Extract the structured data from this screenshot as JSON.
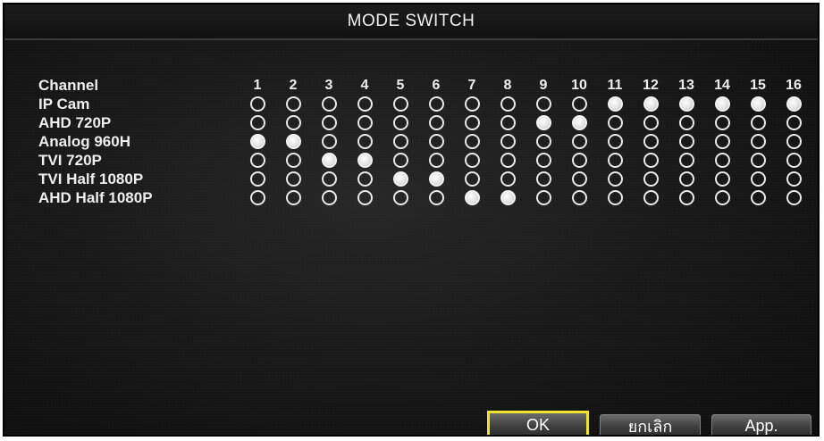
{
  "window": {
    "title": "MODE SWITCH"
  },
  "grid": {
    "header_label": "Channel",
    "channels": [
      "1",
      "2",
      "3",
      "4",
      "5",
      "6",
      "7",
      "8",
      "9",
      "10",
      "11",
      "12",
      "13",
      "14",
      "15",
      "16"
    ],
    "modes": [
      {
        "label": "IP Cam",
        "selected": [
          11,
          12,
          13,
          14,
          15,
          16
        ]
      },
      {
        "label": "AHD 720P",
        "selected": [
          9,
          10
        ]
      },
      {
        "label": "Analog 960H",
        "selected": [
          1,
          2
        ]
      },
      {
        "label": "TVI 720P",
        "selected": [
          3,
          4
        ]
      },
      {
        "label": "TVI Half 1080P",
        "selected": [
          5,
          6
        ]
      },
      {
        "label": "AHD Half 1080P",
        "selected": [
          7,
          8
        ]
      }
    ]
  },
  "buttons": {
    "ok": "OK",
    "cancel": "ยกเลิก",
    "app": "App."
  },
  "colors": {
    "highlight": "#f2e230",
    "background": "#161616",
    "text": "#eeeeee"
  }
}
